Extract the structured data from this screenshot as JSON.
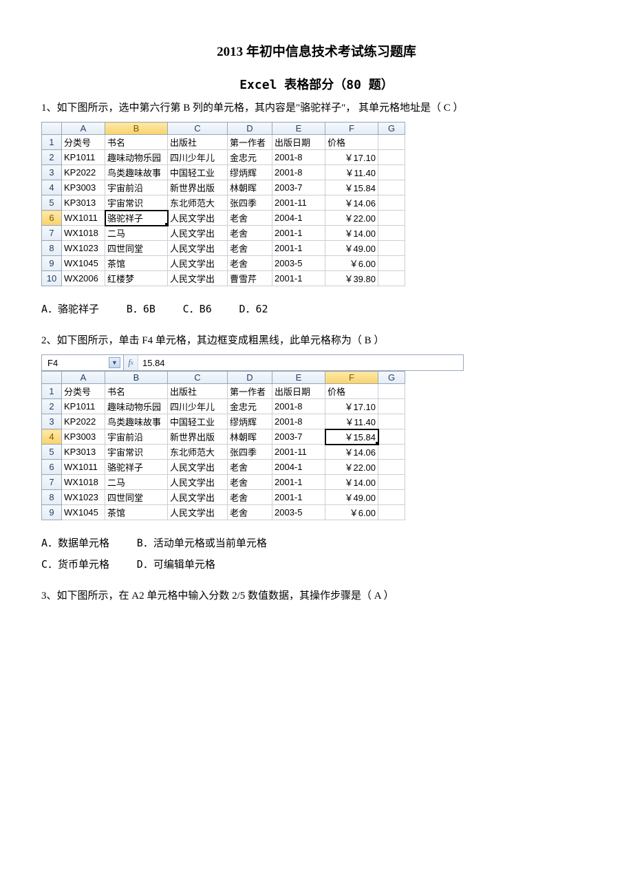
{
  "title": "2013 年初中信息技术考试练习题库",
  "subtitle": "Excel 表格部分（80 题）",
  "q1": {
    "text": "1、如下图所示，选中第六行第 B 列的单元格，其内容是\"骆驼祥子\"， 其单元格地址是（   C      ）",
    "options": {
      "a": "A．骆驼祥子",
      "b": "B．6B",
      "c": "C．B6",
      "d": "D．62"
    }
  },
  "q2": {
    "text": "2、如下图所示，单击 F4 单元格，其边框变成粗黑线，此单元格称为（     B     ）",
    "namebox": "F4",
    "fx": "15.84",
    "options": {
      "a": "A．数据单元格",
      "b": "B．活动单元格或当前单元格",
      "c": "C．货币单元格",
      "d": "D．可编辑单元格"
    }
  },
  "q3": {
    "text": "3、如下图所示，在 A2 单元格中输入分数 2/5 数值数据，其操作步骤是（     A       ）"
  },
  "cols": [
    "A",
    "B",
    "C",
    "D",
    "E",
    "F",
    "G"
  ],
  "hdr": {
    "a": "分类号",
    "b": "书名",
    "c": "出版社",
    "d": "第一作者",
    "e": "出版日期",
    "f": "价格"
  },
  "rows1": [
    {
      "n": "2",
      "a": "KP1011",
      "b": "趣味动物乐园",
      "c": "四川少年儿",
      "d": "金忠元",
      "e": "2001-8",
      "f": "￥17.10"
    },
    {
      "n": "3",
      "a": "KP2022",
      "b": "鸟类趣味故事",
      "c": "中国轻工业",
      "d": "缪炳辉",
      "e": "2001-8",
      "f": "￥11.40"
    },
    {
      "n": "4",
      "a": "KP3003",
      "b": "宇宙前沿",
      "c": "新世界出版",
      "d": "林朝晖",
      "e": "2003-7",
      "f": "￥15.84"
    },
    {
      "n": "5",
      "a": "KP3013",
      "b": "宇宙常识",
      "c": "东北师范大",
      "d": "张四季",
      "e": "2001-11",
      "f": "￥14.06"
    },
    {
      "n": "6",
      "a": "WX1011",
      "b": "骆驼祥子",
      "c": "人民文学出",
      "d": "老舍",
      "e": "2004-1",
      "f": "￥22.00"
    },
    {
      "n": "7",
      "a": "WX1018",
      "b": "二马",
      "c": "人民文学出",
      "d": "老舍",
      "e": "2001-1",
      "f": "￥14.00"
    },
    {
      "n": "8",
      "a": "WX1023",
      "b": "四世同堂",
      "c": "人民文学出",
      "d": "老舍",
      "e": "2001-1",
      "f": "￥49.00"
    },
    {
      "n": "9",
      "a": "WX1045",
      "b": "茶馆",
      "c": "人民文学出",
      "d": "老舍",
      "e": "2003-5",
      "f": "￥6.00"
    },
    {
      "n": "10",
      "a": "WX2006",
      "b": "红楼梦",
      "c": "人民文学出",
      "d": "曹雪芹",
      "e": "2001-1",
      "f": "￥39.80"
    }
  ],
  "rows2": [
    {
      "n": "2",
      "a": "KP1011",
      "b": "趣味动物乐园",
      "c": "四川少年儿",
      "d": "金忠元",
      "e": "2001-8",
      "f": "￥17.10"
    },
    {
      "n": "3",
      "a": "KP2022",
      "b": "鸟类趣味故事",
      "c": "中国轻工业",
      "d": "缪炳辉",
      "e": "2001-8",
      "f": "￥11.40"
    },
    {
      "n": "4",
      "a": "KP3003",
      "b": "宇宙前沿",
      "c": "新世界出版",
      "d": "林朝晖",
      "e": "2003-7",
      "f": "￥15.84"
    },
    {
      "n": "5",
      "a": "KP3013",
      "b": "宇宙常识",
      "c": "东北师范大",
      "d": "张四季",
      "e": "2001-11",
      "f": "￥14.06"
    },
    {
      "n": "6",
      "a": "WX1011",
      "b": "骆驼祥子",
      "c": "人民文学出",
      "d": "老舍",
      "e": "2004-1",
      "f": "￥22.00"
    },
    {
      "n": "7",
      "a": "WX1018",
      "b": "二马",
      "c": "人民文学出",
      "d": "老舍",
      "e": "2001-1",
      "f": "￥14.00"
    },
    {
      "n": "8",
      "a": "WX1023",
      "b": "四世同堂",
      "c": "人民文学出",
      "d": "老舍",
      "e": "2001-1",
      "f": "￥49.00"
    },
    {
      "n": "9",
      "a": "WX1045",
      "b": "茶馆",
      "c": "人民文学出",
      "d": "老舍",
      "e": "2003-5",
      "f": "￥6.00"
    }
  ]
}
